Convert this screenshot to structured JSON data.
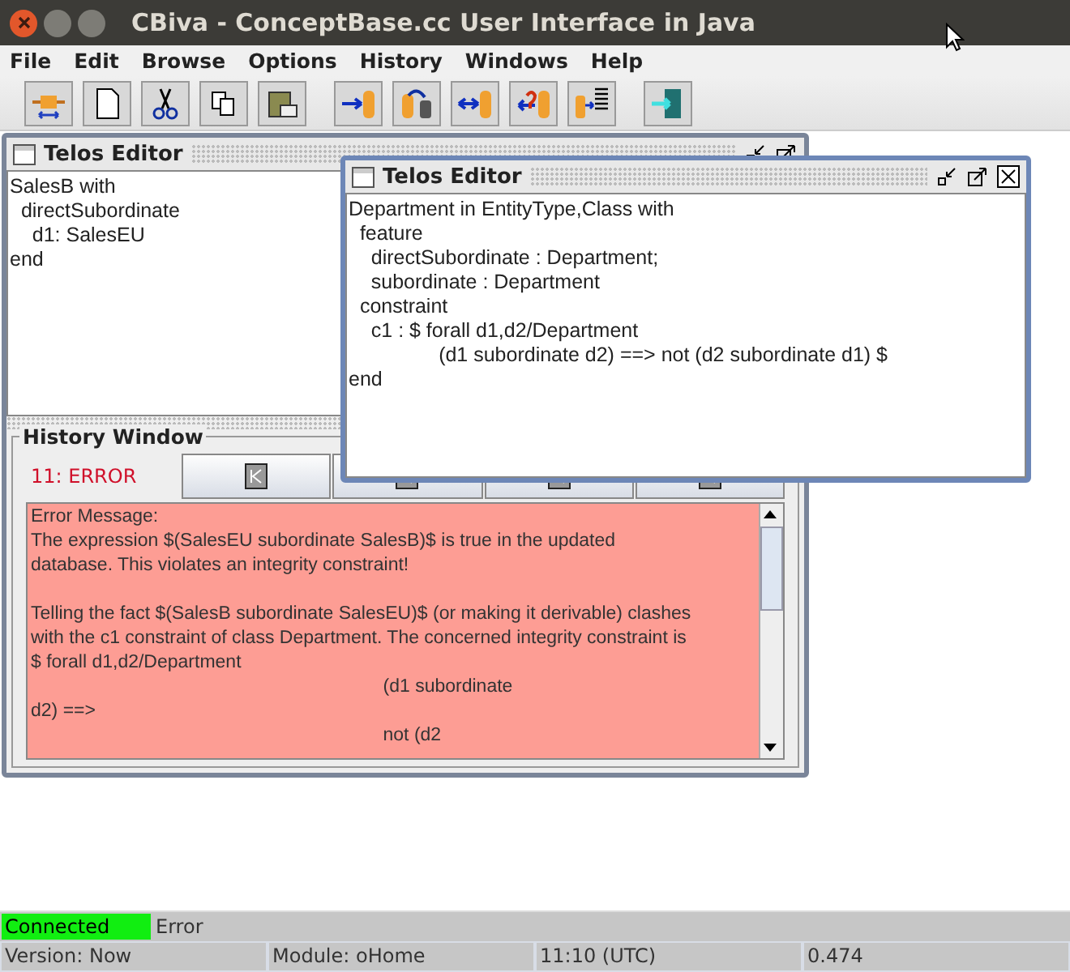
{
  "window": {
    "title": "CBiva - ConceptBase.cc User Interface in Java"
  },
  "menu": [
    "File",
    "Edit",
    "Browse",
    "Options",
    "History",
    "Windows",
    "Help"
  ],
  "editors": [
    {
      "title": "Telos Editor",
      "active": false,
      "lines": [
        "SalesB with",
        "  directSubordinate",
        "    d1: SalesEU",
        "end"
      ]
    },
    {
      "title": "Telos Editor",
      "active": true,
      "lines": [
        "Department in EntityType,Class with",
        "  feature",
        "    directSubordinate : Department;",
        "    subordinate : Department",
        "  constraint",
        "    c1 : $ forall d1,d2/Department",
        "                (d1 subordinate d2) ==> not (d2 subordinate d1) $",
        "end"
      ]
    }
  ],
  "history": {
    "title": "History Window",
    "entry": "11:  ERROR",
    "message_paragraphs": [
      [
        "Error Message:",
        "The expression $(SalesEU subordinate SalesB)$ is true in the updated",
        "database. This violates an integrity constraint!"
      ],
      [
        "Telling the fact $(SalesB subordinate SalesEU)$ (or making it derivable) clashes",
        "with the c1 constraint of class Department. The concerned integrity constraint is",
        "$ forall d1,d2/Department",
        "                                                                    (d1 subordinate",
        "d2) ==>",
        "                                                                    not (d2"
      ]
    ]
  },
  "status_bar": {
    "connected": true,
    "connection": "Connected",
    "message": "Error",
    "version": "Version: Now",
    "module": "Module: oHome",
    "time": "11:10 (UTC)",
    "value": "0.474"
  }
}
